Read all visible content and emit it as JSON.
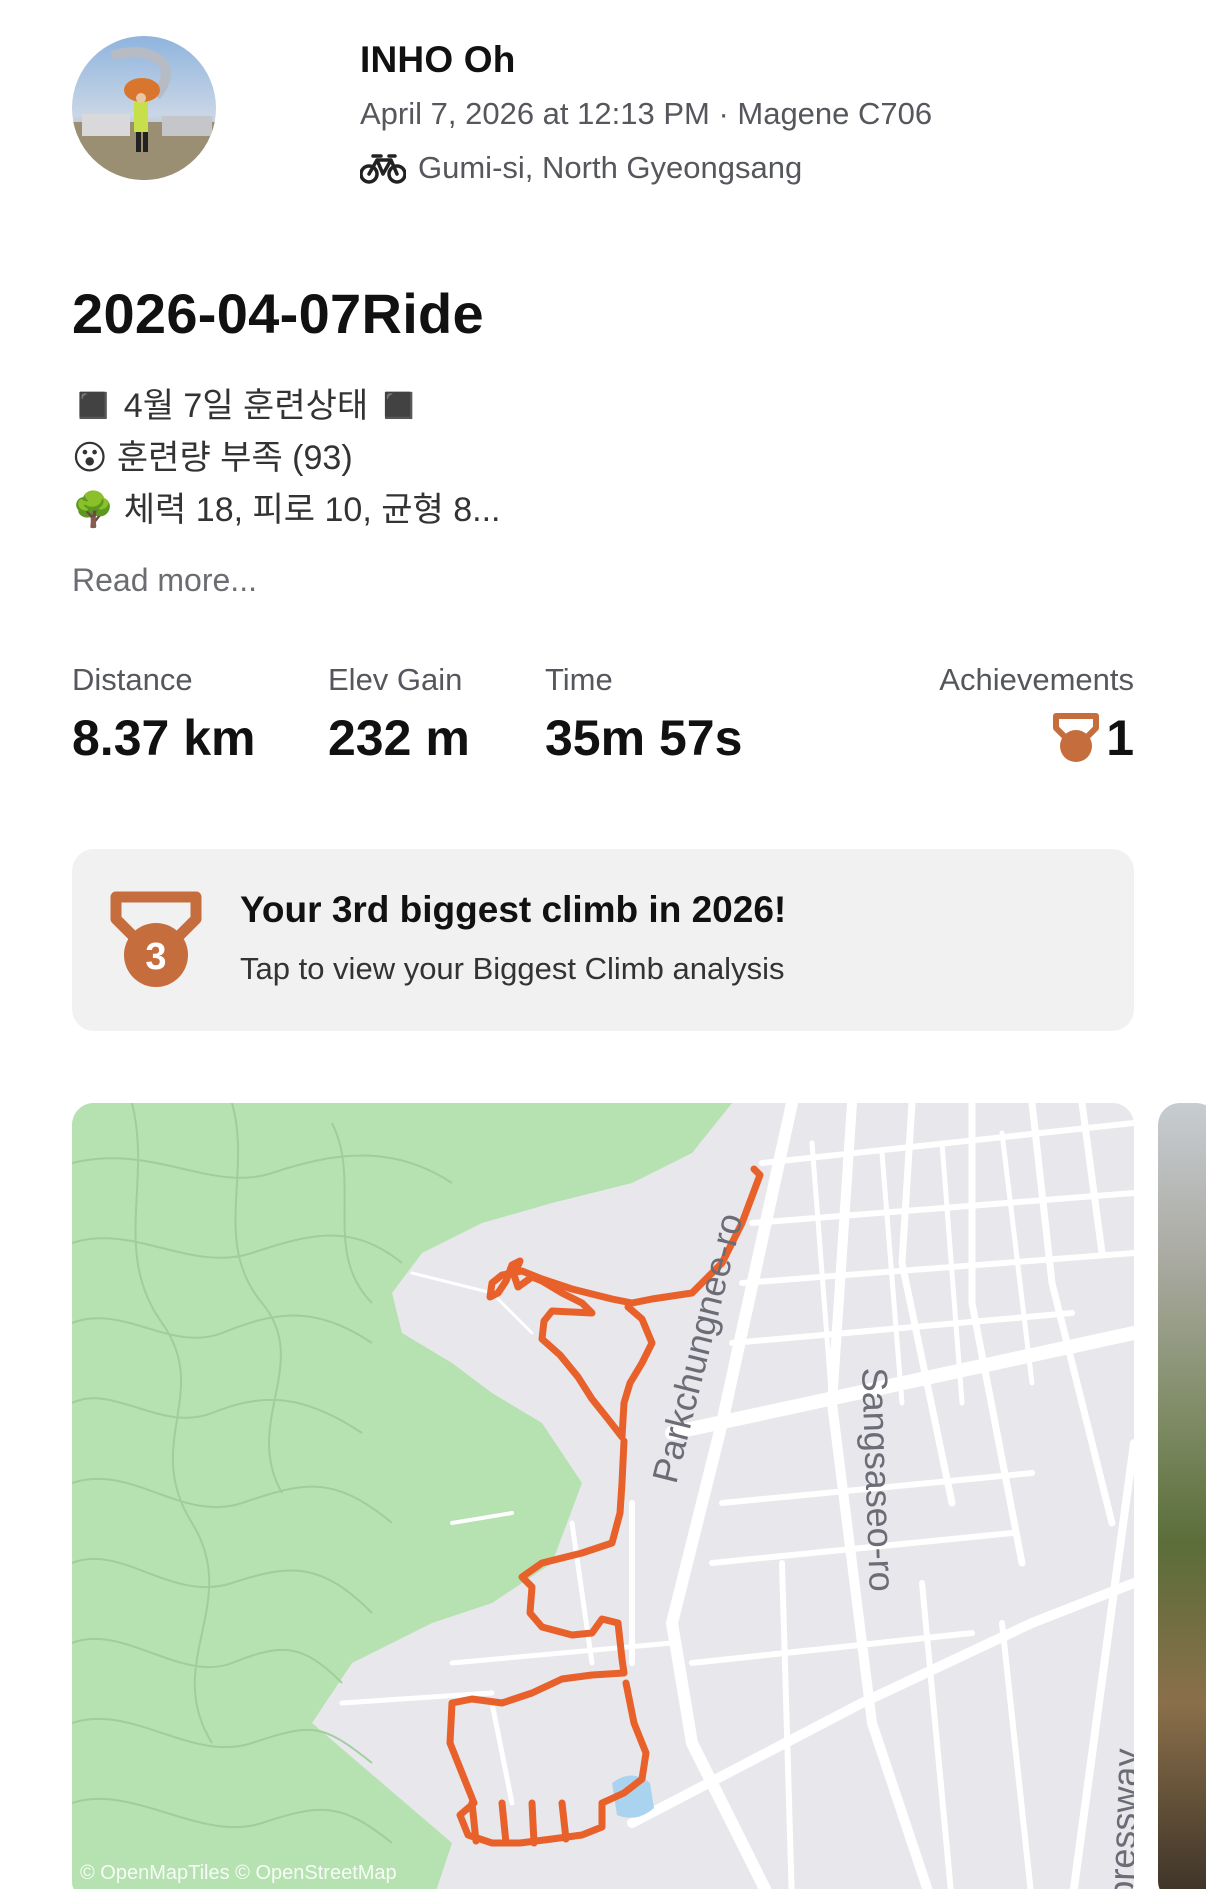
{
  "header": {
    "athlete_name": "INHO Oh",
    "meta": "April 7, 2026 at 12:13 PM · Magene C706",
    "location": "Gumi-si, North Gyeongsang"
  },
  "activity": {
    "title": "2026-04-07Ride",
    "description": [
      "◼️ 4월 7일 훈련상태 ◼️",
      "😮 훈련량 부족 (93)",
      "🌳 체력 18, 피로 10, 균형 8..."
    ],
    "read_more": "Read more..."
  },
  "stats": {
    "distance_label": "Distance",
    "distance_value": "8.37 km",
    "elev_label": "Elev Gain",
    "elev_value": "232 m",
    "time_label": "Time",
    "time_value": "35m 57s",
    "achievements_label": "Achievements",
    "achievements_value": "1"
  },
  "achievement_card": {
    "medal_number": "3",
    "title": "Your 3rd biggest climb in 2026!",
    "subtitle": "Tap to view your Biggest Climb analysis"
  },
  "map": {
    "road_labels": [
      "Parkchungnee-ro",
      "Sangsaseo-ro",
      "Expressway"
    ],
    "attribution": "© OpenMapTiles © OpenStreetMap"
  },
  "colors": {
    "route": "#e8612a",
    "bronze": "#c66d3e",
    "park": "#b5e2b0",
    "land": "#e7e7ec",
    "card_bg": "#f1f1f1"
  },
  "icons": {
    "activity_type": "bike-icon",
    "achievement": "bronze-medal-icon"
  }
}
